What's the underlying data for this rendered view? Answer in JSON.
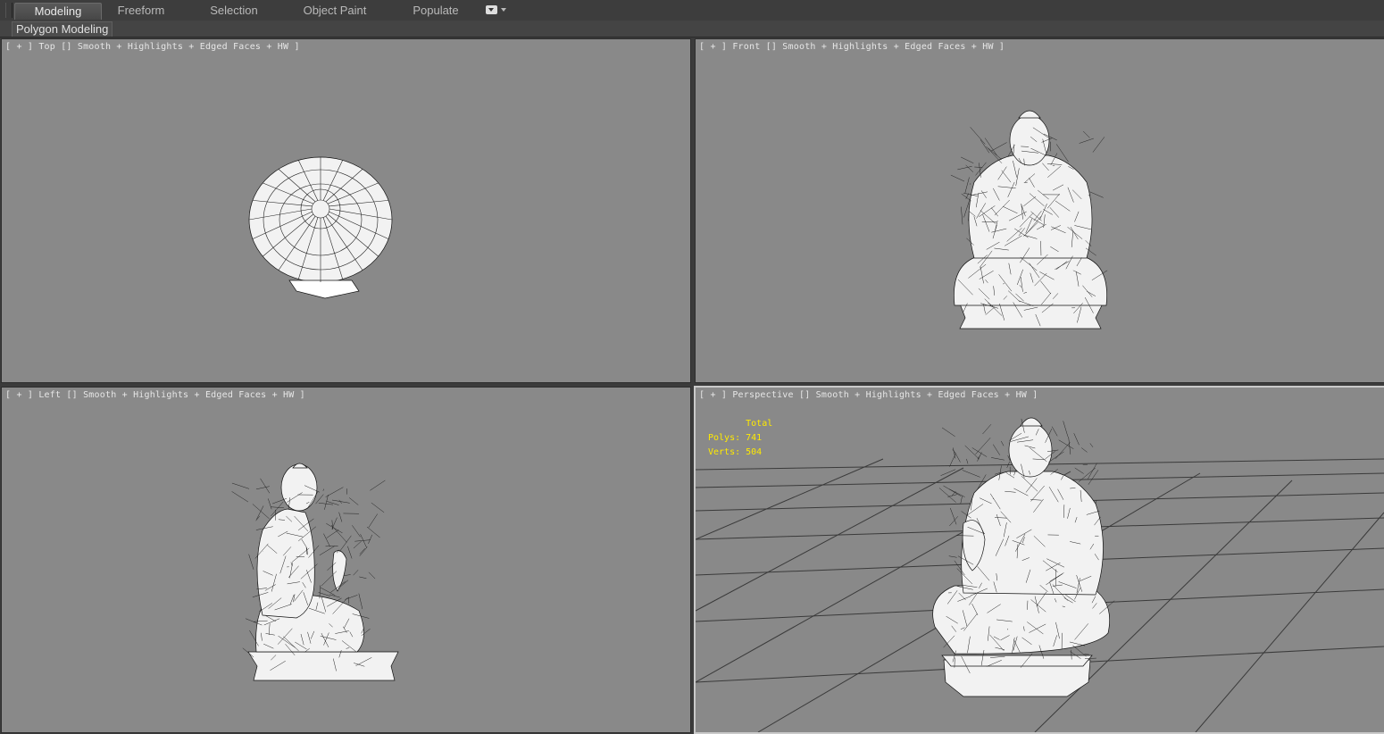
{
  "ribbon": {
    "tabs": [
      {
        "label": "Modeling",
        "active": true
      },
      {
        "label": "Freeform",
        "active": false
      },
      {
        "label": "Selection",
        "active": false
      },
      {
        "label": "Object Paint",
        "active": false
      },
      {
        "label": "Populate",
        "active": false
      }
    ],
    "dropdown_icon": "dropdown-toggle-icon",
    "subtab": "Polygon Modeling"
  },
  "viewports": {
    "top": {
      "label": "[ + ] Top [] Smooth + Highlights + Edged Faces + HW ]"
    },
    "front": {
      "label": "[ + ] Front [] Smooth + Highlights + Edged Faces + HW ]"
    },
    "left": {
      "label": "[ + ] Left [] Smooth + Highlights + Edged Faces + HW ]"
    },
    "perspective": {
      "label": "[ + ] Perspective [] Smooth + Highlights + Edged Faces + HW ]",
      "stats": {
        "header": "       Total",
        "polys": "Polys: 741",
        "verts": "Verts: 504"
      }
    }
  },
  "colors": {
    "viewport_bg": "#898989",
    "ui_bg": "#3b3b3b",
    "stats_text": "#ffea00",
    "active_border": "#c9c9c9"
  }
}
